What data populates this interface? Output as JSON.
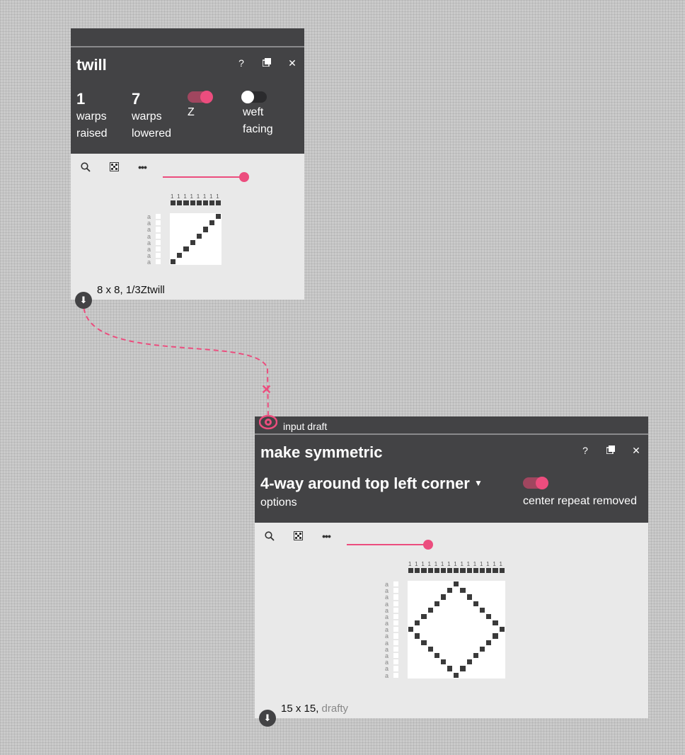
{
  "twill": {
    "title": "twill",
    "icons": [
      "help-icon",
      "duplicate-icon",
      "close-icon"
    ],
    "help": "?",
    "close": "✕",
    "warps_raised": {
      "value": "1",
      "label1": "warps",
      "label2": "raised"
    },
    "warps_lowered": {
      "value": "7",
      "label1": "warps",
      "label2": "lowered"
    },
    "direction": {
      "label": "Z",
      "on": true
    },
    "weft_facing": {
      "label1": "weft",
      "label2": "facing",
      "on": false
    },
    "zoom_level": 0.9,
    "draft_size": 8,
    "warp_numbers": [
      "1",
      "1",
      "1",
      "1",
      "1",
      "1",
      "1",
      "1"
    ],
    "weft_labels": [
      "a",
      "a",
      "a",
      "a",
      "a",
      "a",
      "a",
      "a"
    ],
    "footer": "8 x 8, 1/3Ztwill"
  },
  "make_symmetric": {
    "input_label": "input draft",
    "title": "make symmetric",
    "help": "?",
    "close": "✕",
    "option_value": "4-way around top left corner",
    "option_label": "options",
    "center_repeat": {
      "label": "center repeat removed",
      "on": true
    },
    "zoom_level": 0.9,
    "draft_size": 15,
    "warp_numbers": [
      "1",
      "1",
      "1",
      "1",
      "1",
      "1",
      "1",
      "1",
      "1",
      "1",
      "1",
      "1",
      "1",
      "1",
      "1"
    ],
    "weft_labels": [
      "a",
      "a",
      "a",
      "a",
      "a",
      "a",
      "a",
      "a",
      "a",
      "a",
      "a",
      "a",
      "a",
      "a",
      "a"
    ],
    "footer_size": "15 x 15,",
    "footer_name": "drafty"
  },
  "connection": {
    "delete_glyph": "✕"
  },
  "colors": {
    "accent": "#ec4d7e",
    "panel_dark": "#434345",
    "panel_light": "#e9e9e9"
  }
}
